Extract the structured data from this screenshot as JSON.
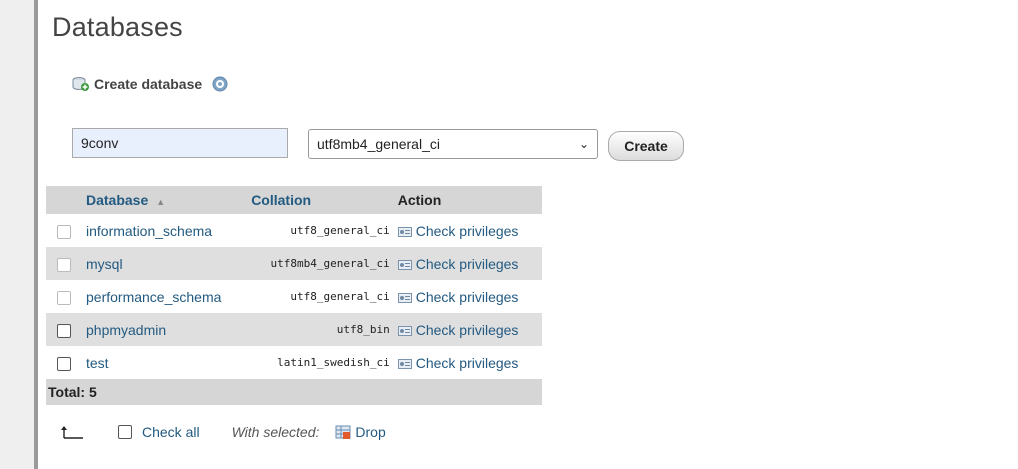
{
  "page": {
    "title": "Databases"
  },
  "create_db": {
    "heading": "Create database",
    "name_value": "9conv",
    "collation_selected": "utf8mb4_general_ci",
    "create_label": "Create"
  },
  "table": {
    "headers": {
      "database": "Database",
      "collation": "Collation",
      "action": "Action"
    },
    "rows": [
      {
        "name": "information_schema",
        "collation": "utf8_general_ci",
        "action": "Check privileges"
      },
      {
        "name": "mysql",
        "collation": "utf8mb4_general_ci",
        "action": "Check privileges"
      },
      {
        "name": "performance_schema",
        "collation": "utf8_general_ci",
        "action": "Check privileges"
      },
      {
        "name": "phpmyadmin",
        "collation": "utf8_bin",
        "action": "Check privileges"
      },
      {
        "name": "test",
        "collation": "latin1_swedish_ci",
        "action": "Check privileges"
      }
    ],
    "total": "Total: 5"
  },
  "footer": {
    "check_all": "Check all",
    "with_selected": "With selected:",
    "drop": "Drop"
  },
  "icons": {
    "create_db": "database-add-icon",
    "help": "help-icon",
    "sort": "sort-ascending-icon",
    "privileges": "privileges-icon",
    "select_arrow": "arrow-up-left-icon",
    "drop": "drop-icon"
  },
  "colors": {
    "link": "#235a81",
    "header_bg": "#d6d6d6",
    "row_alt_bg": "#dfdfdf",
    "input_bg": "#e8f0fe"
  }
}
